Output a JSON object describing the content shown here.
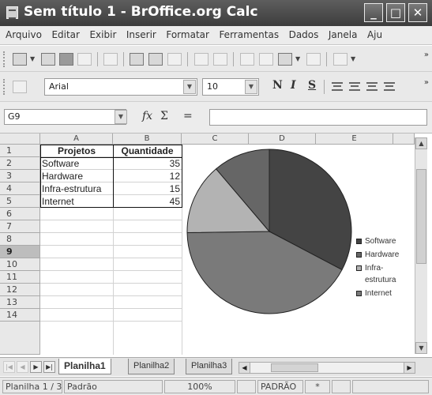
{
  "window": {
    "title": "Sem título 1 - BrOffice.org Calc"
  },
  "menu": [
    "Arquivo",
    "Editar",
    "Exibir",
    "Inserir",
    "Formatar",
    "Ferramentas",
    "Dados",
    "Janela",
    "Aju"
  ],
  "formatting": {
    "font_name": "Arial",
    "font_size": "10",
    "bold": "N",
    "italic": "I",
    "underline": "S"
  },
  "formula_bar": {
    "cell_ref": "G9",
    "fx": "fx",
    "sum": "Σ",
    "equals": "=",
    "value": ""
  },
  "columns": [
    "A",
    "B",
    "C",
    "D",
    "E"
  ],
  "rows": [
    "1",
    "2",
    "3",
    "4",
    "5",
    "6",
    "7",
    "8",
    "9",
    "10",
    "11",
    "12",
    "13",
    "14"
  ],
  "selected_row": "9",
  "table": {
    "header": [
      "Projetos",
      "Quantidade"
    ],
    "rows": [
      [
        "Software",
        "35"
      ],
      [
        "Hardware",
        "12"
      ],
      [
        "Infra-estrutura",
        "15"
      ],
      [
        "Internet",
        "45"
      ]
    ]
  },
  "chart_data": {
    "type": "pie",
    "categories": [
      "Software",
      "Hardware",
      "Infra-estrutura",
      "Internet"
    ],
    "values": [
      35,
      12,
      15,
      45
    ],
    "colors": [
      "#444444",
      "#666666",
      "#b3b3b3",
      "#7a7a7a"
    ],
    "legend": [
      "Software",
      "Hardware",
      "Infra-",
      "estrutura",
      "Internet"
    ],
    "legend_position": "right",
    "title": ""
  },
  "sheets": [
    "Planilha1",
    "Planilha2",
    "Planilha3"
  ],
  "active_sheet": "Planilha1",
  "status": {
    "page": "Planilha 1 / 3",
    "style": "Padrão",
    "zoom": "100%",
    "mode": "PADRÃO",
    "modified": "*"
  }
}
